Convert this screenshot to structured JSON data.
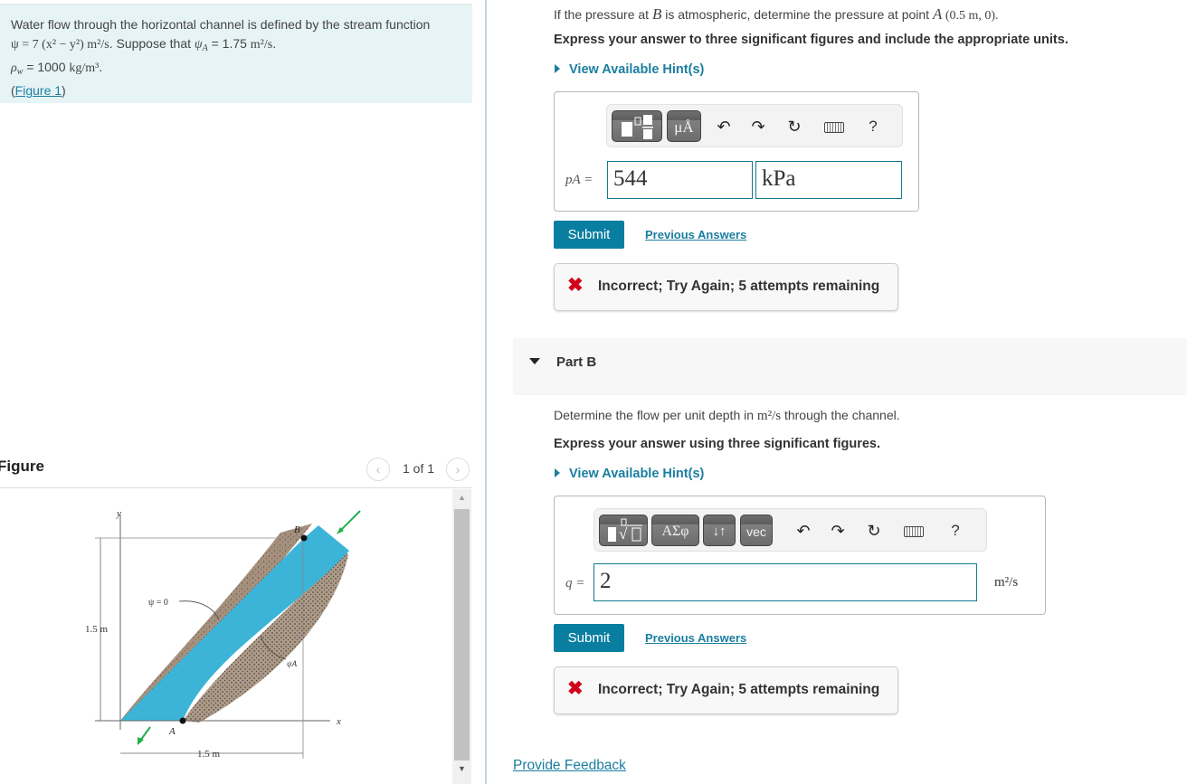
{
  "intro": {
    "line1": "Water flow through the horizontal channel is defined by the stream function",
    "stream_function": "ψ = 7 (x² − y²) m²/s",
    "psi_A_prefix": ". Suppose that ",
    "psi_A_symbol": "ψ",
    "psi_A_sub": "A",
    "psi_A_value": " = 1.75 ",
    "psi_A_unit": "m²/s",
    "rho_symbol": "ρ",
    "rho_sub": "w",
    "rho_value": " = 1000 ",
    "rho_unit": "kg/m³",
    "figure_link_open": "(",
    "figure_link": "Figure 1",
    "figure_link_close": ")"
  },
  "figure_panel": {
    "title": "Figure",
    "pager_text": "1 of 1",
    "prev_icon": "‹",
    "next_icon": "›",
    "labels": {
      "y_axis": "y",
      "x_axis": "x",
      "point_A": "A",
      "point_B": "B",
      "psi_zero": "ψ = 0",
      "psi_A": "ψA",
      "height_dim": "1.5 m",
      "width_dim": "1.5 m"
    }
  },
  "part_a": {
    "question_prefix": "If the pressure at ",
    "question_B": "B",
    "question_mid": " is atmospheric, determine the pressure at point ",
    "question_A": "A",
    "question_coord": " (0.5 m, 0).",
    "instruction": "Express your answer to three significant figures and include the appropriate units.",
    "hint_label": "View Available Hint(s)",
    "toolbar": {
      "buttons": [
        "templates",
        "units"
      ],
      "units_label": "μÅ",
      "undo_icon": "↶",
      "redo_icon": "↷",
      "reset_icon": "↻",
      "help_label": "?"
    },
    "variable_label": "pA =",
    "value": "544",
    "unit_value": "kPa",
    "submit_label": "Submit",
    "previous_answers_label": "Previous Answers",
    "feedback_icon": "✖",
    "feedback_text": "Incorrect; Try Again; 5 attempts remaining"
  },
  "part_b": {
    "title": "Part B",
    "question_prefix": "Determine the flow per unit depth in ",
    "question_unit": "m²/s",
    "question_suffix": " through the channel.",
    "instruction": "Express your answer using three significant figures.",
    "hint_label": "View Available Hint(s)",
    "toolbar": {
      "greek_label": "ΑΣφ",
      "arrows_label": "↓↑",
      "vec_label": "vec",
      "undo_icon": "↶",
      "redo_icon": "↷",
      "reset_icon": "↻",
      "help_label": "?"
    },
    "variable_label": "q =",
    "value": "2",
    "unit": "m²/s",
    "submit_label": "Submit",
    "previous_answers_label": "Previous Answers",
    "feedback_icon": "✖",
    "feedback_text": "Incorrect; Try Again; 5 attempts remaining"
  },
  "footer": {
    "provide_feedback": "Provide Feedback"
  },
  "colors": {
    "accent": "#0a7ea0",
    "link": "#1b7ea0",
    "intro_bg": "#e6f4f6",
    "error": "#d0021b",
    "water": "#3bb4d8",
    "soil": "#9b8572"
  }
}
